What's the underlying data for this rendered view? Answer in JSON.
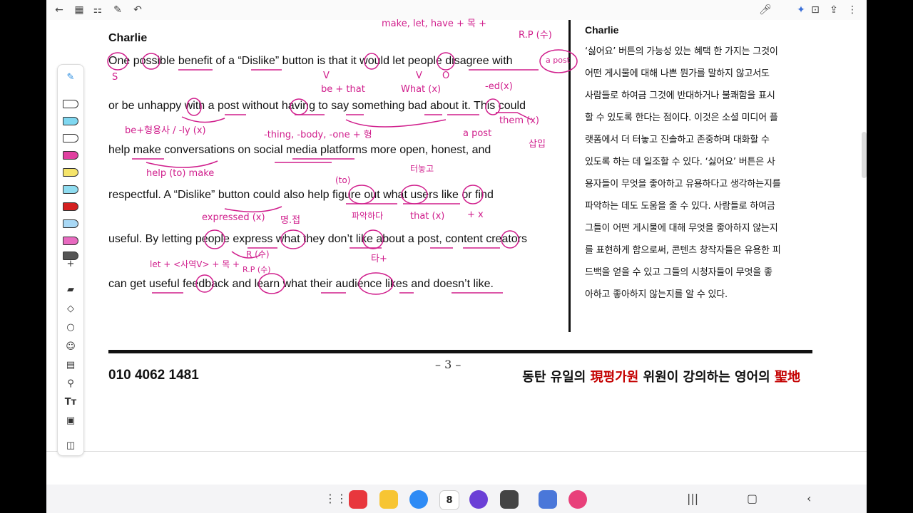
{
  "toolbar_top": {
    "icons": [
      "back-arrow-icon",
      "grid-icon",
      "apps-icon",
      "edit-doc-icon",
      "undo-icon",
      "mic-icon",
      "sparkle-icon",
      "bookmark-icon",
      "share-icon",
      "more-icon"
    ]
  },
  "doc": {
    "english": {
      "name": "Charlie",
      "lines": [
        "One possible benefit of a “Dislike” button is that it would let people disagree with",
        "or be unhappy with a post without having to say something bad about it. This could",
        "help make conversations on social media platforms more open, honest, and",
        "respectful. A “Dislike” button could also help figure out what users like or find",
        "useful. By letting people express what they don’t like about a post, content creators",
        "can get useful feedback and learn what their audience likes and doesn’t like."
      ]
    },
    "korean": {
      "name": "Charlie",
      "lines": [
        "‘싫어요’ 버튼의 가능성 있는 혜택 한 가지는 그것이",
        "어떤 게시물에 대해 나쁜 뭔가를 말하지 않고서도",
        "사람들로 하여금 그것에 반대하거나 불쾌함을 표시",
        "할 수 있도록 한다는 점이다. 이것은 소셜 미디어 플",
        "랫폼에서 더 터놓고 진솔하고 존중하며 대화할 수",
        "있도록 하는 데 일조할 수 있다. ‘싫어요’ 버튼은 사",
        "용자들이 무엇을 좋아하고 유용하다고 생각하는지를",
        "파악하는 데도 도움을 줄 수 있다. 사람들로 하여금",
        "그들이 어떤 게시물에 대해 무엇을 좋아하지 않는지",
        "를 표현하게 함으로써, 콘텐츠 창작자들은 유용한 피",
        "드백을 얻을 수 있고 그들의 시청자들이 무엇을 좋",
        "아하고 좋아하지 않는지를 알 수 있다."
      ]
    },
    "page_number": "– 3 –",
    "phone": "010  4062  1481",
    "slogan_a": "동탄 유일의 ",
    "slogan_red1": "現평가원",
    "slogan_b": " 위원이 강의하는 영어의 ",
    "slogan_red2": "聖地"
  },
  "handwriting": [
    "make, let, have + 목 +",
    "R.P (수)",
    "a post",
    "S",
    "V",
    "V",
    "O",
    "be + that",
    "What (x)",
    "-ed(x)",
    "be+형용사 / -ly (x)",
    "-thing, -body, -one + 형",
    "a post",
    "them (x)",
    "삽입",
    "help (to) make",
    "(to)",
    "터놓고",
    "expressed (x)",
    "명.접",
    "파악하다",
    "that (x)",
    "+ x",
    "R (수)",
    "let + <사역V> + 목 +",
    "R.P (수)",
    "타+"
  ],
  "side_tools": [
    "pen-icon",
    "pen-black-icon",
    "pen-cyan-icon",
    "pen-black2-icon",
    "highlighter-pink-icon",
    "highlighter-yellow-icon",
    "highlighter-cyan-icon",
    "pen-red-icon",
    "highlighter-blue-icon",
    "highlighter-magenta-icon",
    "pen-dark-icon",
    "add-icon",
    "eraser-icon",
    "shapes-icon",
    "lasso-icon",
    "sticker-icon",
    "comment-icon",
    "link-icon",
    "text-icon",
    "image-icon",
    "page-icon"
  ],
  "side_tools_text": "+",
  "navbar": {
    "apps": [
      "notes-app-icon",
      "folder-app-icon",
      "messages-app-icon",
      "calendar-app-icon",
      "browser-app-icon",
      "camera-app-icon",
      "email-app-icon",
      "gallery-app-icon"
    ],
    "calendar_day": "8",
    "colors": {
      "notes": "#e8373d",
      "folder": "#f7c533",
      "messages": "#2e8bf5",
      "calendar": "#ffffff",
      "browser": "#6b3fd6",
      "camera": "#444444",
      "email": "#4a77d9",
      "gallery": "#e8407a"
    }
  },
  "colors": {
    "ink": "#d01e8c",
    "slogan_red": "#c40000"
  }
}
